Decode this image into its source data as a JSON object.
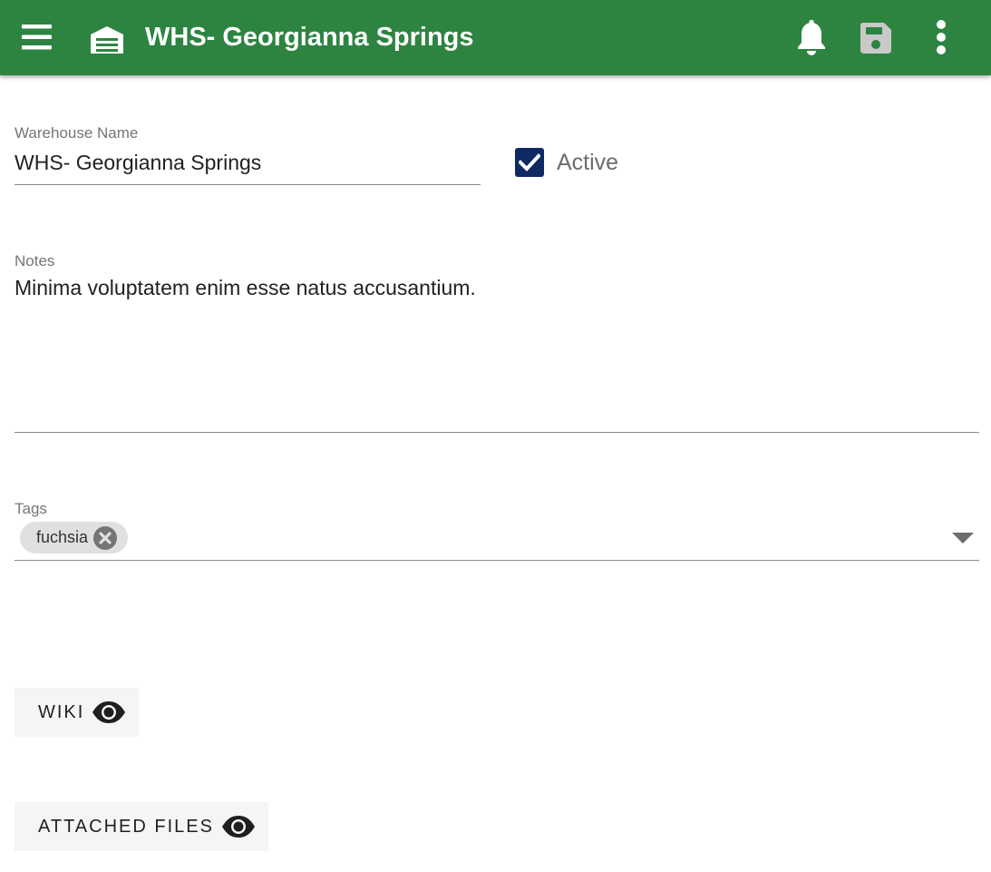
{
  "app_bar": {
    "title": "WHS- Georgianna Springs",
    "menu_icon": "hamburger-menu-icon",
    "entity_icon": "warehouse-icon",
    "actions": [
      {
        "name": "notifications",
        "icon": "bell-icon"
      },
      {
        "name": "save",
        "icon": "save-icon"
      },
      {
        "name": "more",
        "icon": "more-vertical-icon"
      }
    ],
    "color": "#2c8440"
  },
  "form": {
    "warehouse_name": {
      "label": "Warehouse Name",
      "value": "WHS- Georgianna Springs"
    },
    "active": {
      "label": "Active",
      "checked": true,
      "color": "#0f2a63"
    },
    "notes": {
      "label": "Notes",
      "value": "Minima voluptatem enim esse natus accusantium."
    },
    "tags": {
      "label": "Tags",
      "chips": [
        {
          "label": "fuchsia"
        }
      ],
      "remove_icon": "close-circle-icon",
      "dropdown_icon": "caret-down-icon"
    }
  },
  "buttons": {
    "wiki": {
      "label": "WIKI",
      "icon": "eye-icon"
    },
    "attached_files": {
      "label": "ATTACHED FILES",
      "icon": "eye-icon"
    }
  }
}
